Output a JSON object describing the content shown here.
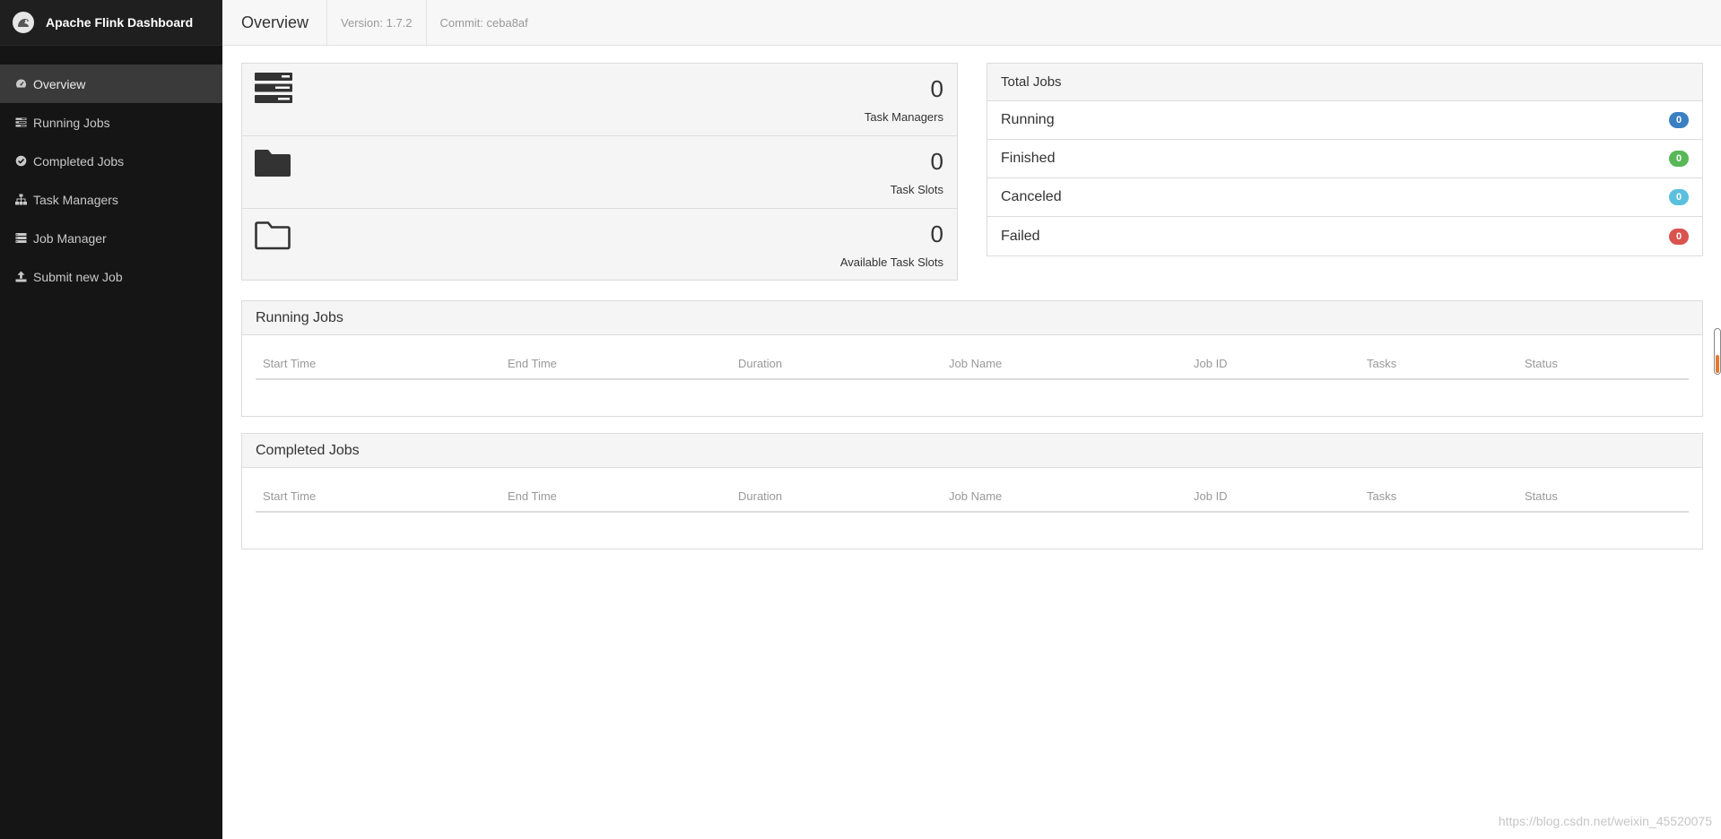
{
  "brand": {
    "title": "Apache Flink Dashboard",
    "logo_icon": "squirrel-logo-icon"
  },
  "sidebar": {
    "items": [
      {
        "label": "Overview",
        "icon": "dashboard-icon",
        "active": true
      },
      {
        "label": "Running Jobs",
        "icon": "tasks-icon",
        "active": false
      },
      {
        "label": "Completed Jobs",
        "icon": "check-circle-icon",
        "active": false
      },
      {
        "label": "Task Managers",
        "icon": "sitemap-icon",
        "active": false
      },
      {
        "label": "Job Manager",
        "icon": "server-list-icon",
        "active": false
      },
      {
        "label": "Submit new Job",
        "icon": "upload-icon",
        "active": false
      }
    ]
  },
  "header": {
    "title": "Overview",
    "version": "Version: 1.7.2",
    "commit": "Commit: ceba8af"
  },
  "stats": [
    {
      "value": "0",
      "label": "Task Managers",
      "icon": "server-stack-icon"
    },
    {
      "value": "0",
      "label": "Task Slots",
      "icon": "folder-solid-icon"
    },
    {
      "value": "0",
      "label": "Available Task Slots",
      "icon": "folder-outline-icon"
    }
  ],
  "total_jobs": {
    "title": "Total Jobs",
    "rows": [
      {
        "label": "Running",
        "count": "0",
        "color": "#3a7fc1"
      },
      {
        "label": "Finished",
        "count": "0",
        "color": "#58b858"
      },
      {
        "label": "Canceled",
        "count": "0",
        "color": "#5bc0de"
      },
      {
        "label": "Failed",
        "count": "0",
        "color": "#d9534f"
      }
    ]
  },
  "running_jobs": {
    "title": "Running Jobs",
    "columns": [
      "Start Time",
      "End Time",
      "Duration",
      "Job Name",
      "Job ID",
      "Tasks",
      "Status"
    ]
  },
  "completed_jobs": {
    "title": "Completed Jobs",
    "columns": [
      "Start Time",
      "End Time",
      "Duration",
      "Job Name",
      "Job ID",
      "Tasks",
      "Status"
    ]
  },
  "watermark": "https://blog.csdn.net/weixin_45520075",
  "colors": {
    "sidebar_bg": "#151515",
    "active_item": "#3a3a3a",
    "scroll_accent": "#e8782f"
  }
}
